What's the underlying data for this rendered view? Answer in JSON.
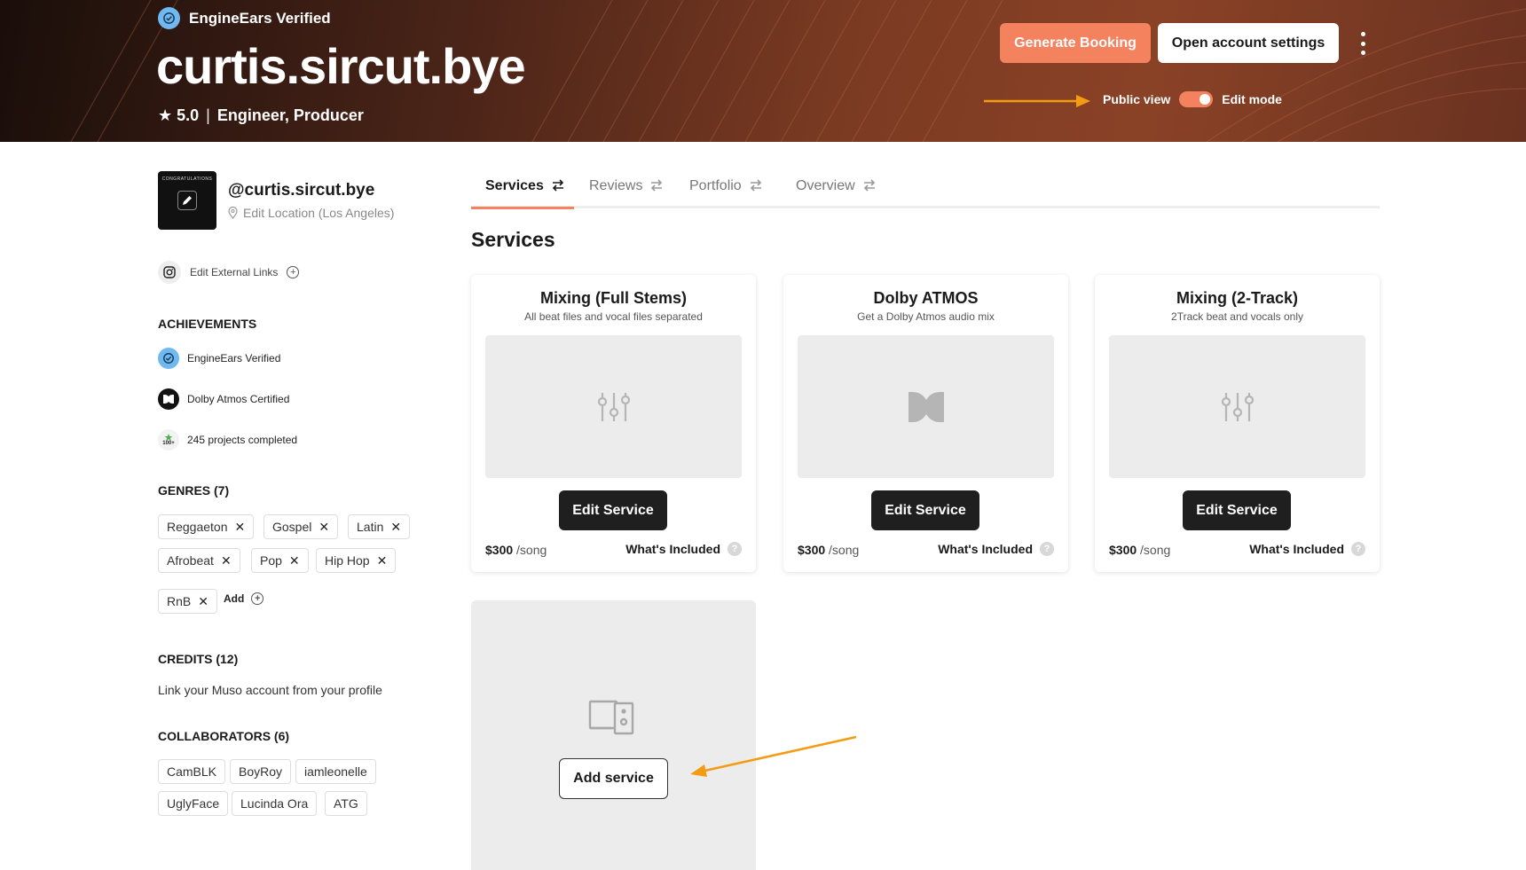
{
  "header": {
    "verified_label": "EngineEars Verified",
    "title": "curtis.sircut.bye",
    "rating": "★ 5.0",
    "separator": "|",
    "roles": "Engineer, Producer",
    "generate_booking_label": "Generate Booking",
    "open_settings_label": "Open account settings",
    "public_view_label": "Public view",
    "edit_mode_label": "Edit mode",
    "accent_color": "#f5825f"
  },
  "profile": {
    "avatar_caption": "CONGRATULATIONS",
    "handle": "@curtis.sircut.bye",
    "location": "Edit Location (Los Angeles)",
    "external_links_label": "Edit External Links",
    "achievements_heading": "ACHIEVEMENTS",
    "achievements": [
      {
        "label": "EngineEars Verified",
        "icon": "verified-icon"
      },
      {
        "label": "Dolby Atmos Certified",
        "icon": "dolby-icon"
      },
      {
        "label": "245 projects completed",
        "icon": "hundred-plus-icon",
        "badge_text": "100+"
      }
    ],
    "genres_heading": "GENRES (7)",
    "genres": [
      "Reggaeton",
      "Gospel",
      "Latin",
      "Afrobeat",
      "Pop",
      "Hip Hop",
      "RnB"
    ],
    "remove_glyph": "✕",
    "add_label": "Add",
    "credits_heading": "CREDITS (12)",
    "credits_text": "Link your Muso account from your profile",
    "collaborators_heading": "COLLABORATORS (6)",
    "collaborators": [
      "CamBLK",
      "BoyRoy",
      "iamleonelle",
      "UglyFace",
      "Lucinda Ora",
      "ATG"
    ]
  },
  "tabs": [
    {
      "label": "Services",
      "active": true
    },
    {
      "label": "Reviews",
      "active": false
    },
    {
      "label": "Portfolio",
      "active": false
    },
    {
      "label": "Overview",
      "active": false
    }
  ],
  "services": {
    "heading": "Services",
    "cards": [
      {
        "title": "Mixing (Full Stems)",
        "subtitle": "All beat files and vocal files separated",
        "icon": "sliders-icon",
        "button": "Edit Service",
        "price": "$300",
        "unit": " /song",
        "included": "What's Included",
        "help": "?"
      },
      {
        "title": "Dolby ATMOS",
        "subtitle": "Get a Dolby Atmos audio mix",
        "icon": "dolby-icon",
        "button": "Edit Service",
        "price": "$300",
        "unit": " /song",
        "included": "What's Included",
        "help": "?"
      },
      {
        "title": "Mixing (2-Track)",
        "subtitle": "2Track beat and vocals only",
        "icon": "sliders-icon",
        "button": "Edit Service",
        "price": "$300",
        "unit": " /song",
        "included": "What's Included",
        "help": "?"
      }
    ],
    "add_service_label": "Add service"
  }
}
